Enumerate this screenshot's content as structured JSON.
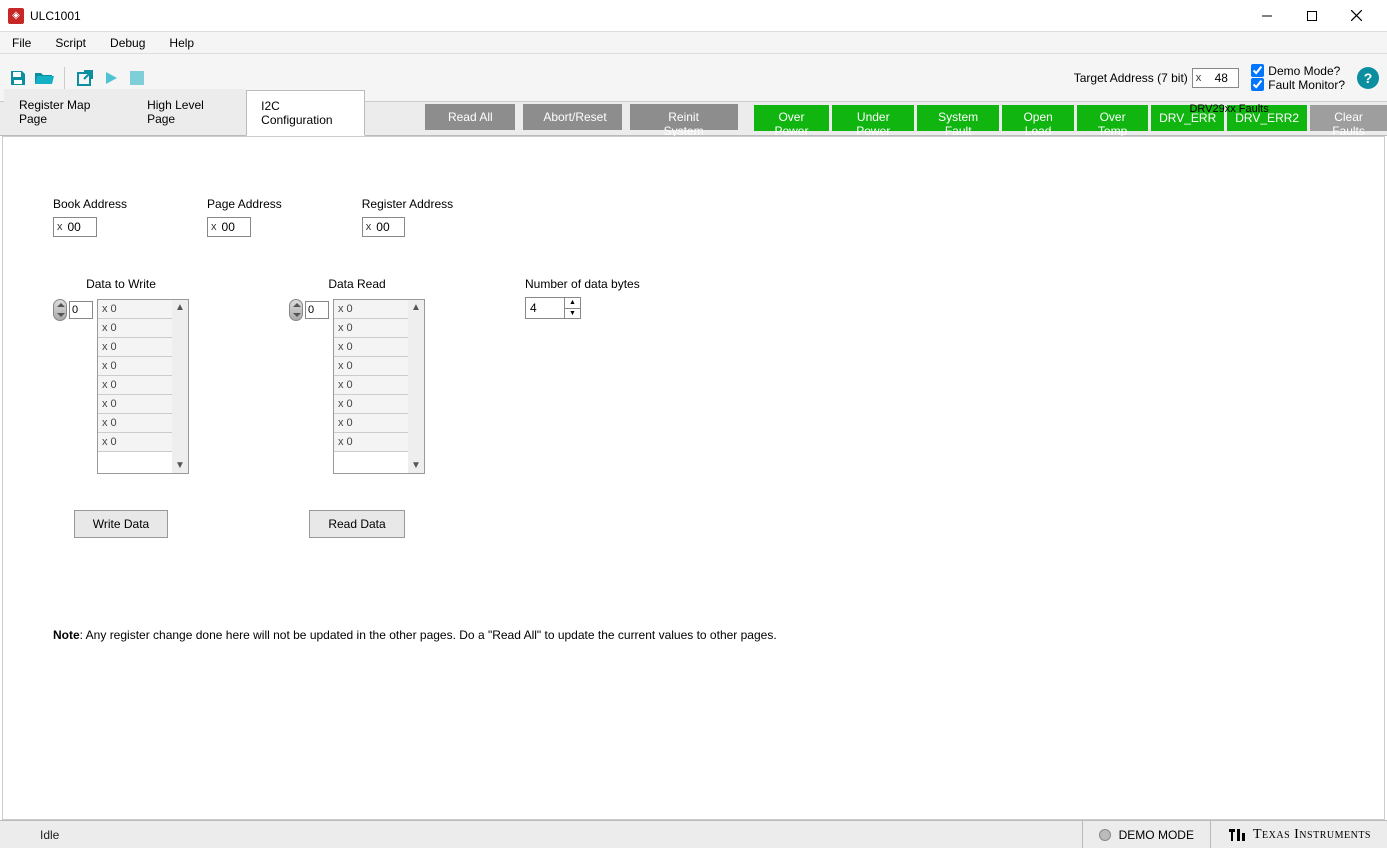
{
  "window": {
    "title": "ULC1001"
  },
  "menu": {
    "file": "File",
    "script": "Script",
    "debug": "Debug",
    "help": "Help"
  },
  "toolbar": {
    "target_label": "Target Address (7 bit)",
    "target_prefix": "x",
    "target_value": "48",
    "demo_mode": "Demo Mode?",
    "fault_monitor": "Fault Monitor?"
  },
  "tabs": {
    "register_map": "Register Map Page",
    "high_level": "High Level Page",
    "i2c_config": "I2C Configuration"
  },
  "actions": {
    "read_all": "Read All",
    "abort_reset": "Abort/Reset",
    "reinit_system": "Reinit System"
  },
  "faults": {
    "over_power": "Over Power",
    "under_power": "Under Power",
    "system_fault": "System Fault",
    "open_load": "Open Load",
    "over_temp": "Over Temp",
    "drv_header": "DRV29xx Faults",
    "drv_err": "DRV_ERR",
    "drv_err2": "DRV_ERR2",
    "clear": "Clear Faults"
  },
  "i2c": {
    "book_label": "Book Address",
    "book_prefix": "x",
    "book_value": "00",
    "page_label": "Page Address",
    "page_prefix": "x",
    "page_value": "00",
    "reg_label": "Register Address",
    "reg_prefix": "x",
    "reg_value": "00",
    "write_label": "Data to Write",
    "read_label": "Data Read",
    "write_index": "0",
    "read_index": "0",
    "num_label": "Number of data bytes",
    "num_value": "4",
    "write_btn": "Write Data",
    "read_btn": "Read Data",
    "cell": "x 0",
    "note_bold": "Note",
    "note_text": ": Any register change done here will not be updated in the other pages. Do a \"Read All\" to update the current values to other pages."
  },
  "status": {
    "idle": "Idle",
    "demo": "DEMO MODE",
    "ti": "Texas Instruments"
  }
}
